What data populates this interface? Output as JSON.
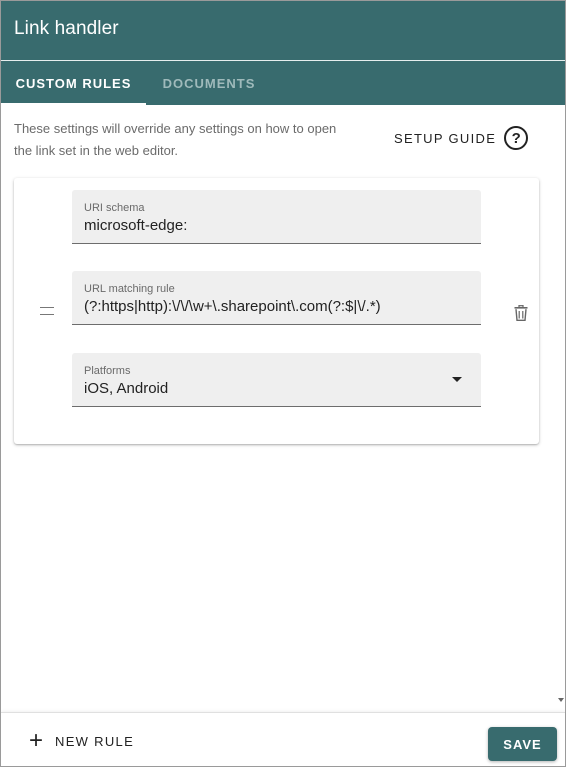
{
  "window": {
    "title": "Link handler"
  },
  "tabs": [
    {
      "label": "CUSTOM RULES",
      "active": true
    },
    {
      "label": "DOCUMENTS",
      "active": false
    }
  ],
  "info_text": "These settings will override any settings on how to open the link set in the web editor.",
  "setup_guide": {
    "label": "SETUP GUIDE",
    "icon": "help-circle-icon"
  },
  "rule": {
    "uri_schema": {
      "label": "URI schema",
      "value": "microsoft-edge:"
    },
    "url_matching_rule": {
      "label": "URL matching rule",
      "value": "(?:https|http):\\/\\/\\w+\\.sharepoint\\.com(?:$|\\/.*)"
    },
    "platforms": {
      "label": "Platforms",
      "value": "iOS, Android"
    },
    "drag_icon": "drag-handle-icon",
    "delete_icon": "trash-icon"
  },
  "footer": {
    "new_rule_label": "NEW RULE",
    "new_rule_icon": "plus-icon",
    "save_label": "SAVE"
  },
  "colors": {
    "primary": "#386b6e",
    "tab_inactive": "#9fbabb",
    "field_bg": "#efefef"
  }
}
